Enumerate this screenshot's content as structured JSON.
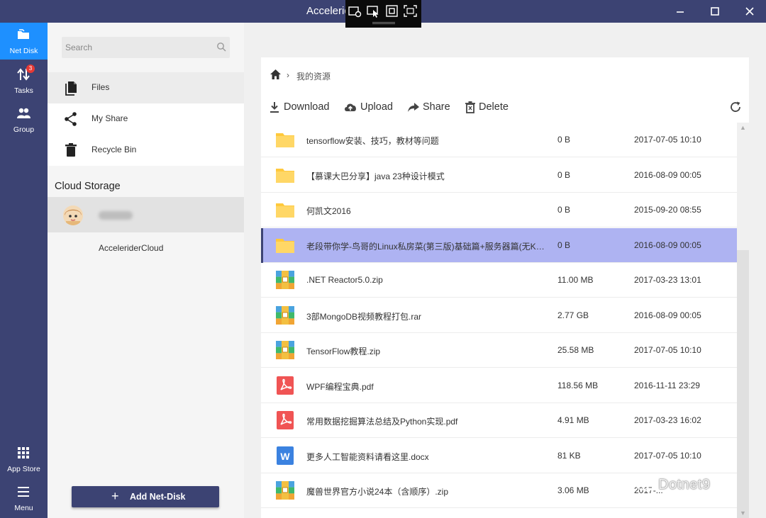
{
  "window": {
    "title": "Accelerider"
  },
  "nav": [
    {
      "label": "Net Disk",
      "icon": "folder-icon",
      "active": true
    },
    {
      "label": "Tasks",
      "icon": "transfer-arrows-icon",
      "badge": "3"
    },
    {
      "label": "Group",
      "icon": "group-icon"
    },
    {
      "label": "App Store",
      "icon": "apps-grid-icon"
    },
    {
      "label": "Menu",
      "icon": "menu-icon"
    }
  ],
  "sidebar": {
    "search_placeholder": "Search",
    "items": [
      {
        "label": "Files",
        "icon": "file-icon"
      },
      {
        "label": "My Share",
        "icon": "share-icon"
      },
      {
        "label": "Recycle Bin",
        "icon": "trash-icon"
      }
    ],
    "cloud_storage_title": "Cloud Storage",
    "cloud_items": [
      "AcceleriderCloud"
    ],
    "add_button": "Add Net-Disk"
  },
  "breadcrumb": {
    "current": "我的资源"
  },
  "actions": [
    "Download",
    "Upload",
    "Share",
    "Delete"
  ],
  "files": [
    {
      "name": "tensorflow安装、技巧，教材等问题",
      "size": "0 B",
      "date": "2017-07-05 10:10",
      "type": "folder"
    },
    {
      "name": "【慕课大巴分享】java 23种设计模式",
      "size": "0 B",
      "date": "2016-08-09 00:05",
      "type": "folder"
    },
    {
      "name": "何凯文2016",
      "size": "0 B",
      "date": "2015-09-20 08:55",
      "type": "folder"
    },
    {
      "name": "老段带你学-鸟哥的Linux私房菜(第三版)基础篇+服务器篇(无KE…",
      "size": "0 B",
      "date": "2016-08-09 00:05",
      "type": "folder",
      "selected": true
    },
    {
      "name": ".NET Reactor5.0.zip",
      "size": "11.00 MB",
      "date": "2017-03-23 13:01",
      "type": "archive"
    },
    {
      "name": "3部MongoDB视频教程打包.rar",
      "size": "2.77 GB",
      "date": "2016-08-09 00:05",
      "type": "archive"
    },
    {
      "name": "TensorFlow教程.zip",
      "size": "25.58 MB",
      "date": "2017-07-05 10:10",
      "type": "archive"
    },
    {
      "name": "WPF编程宝典.pdf",
      "size": "118.56 MB",
      "date": "2016-11-11 23:29",
      "type": "pdf"
    },
    {
      "name": "常用数据挖掘算法总结及Python实现.pdf",
      "size": "4.91 MB",
      "date": "2017-03-23 16:02",
      "type": "pdf"
    },
    {
      "name": "更多人工智能资料请看这里.docx",
      "size": "81 KB",
      "date": "2017-07-05 10:10",
      "type": "word"
    },
    {
      "name": "魔兽世界官方小说24本（含顺序）.zip",
      "size": "3.06 MB",
      "date": "2017-...",
      "type": "archive"
    }
  ],
  "watermark": "Dotnet9",
  "colors": {
    "nav": "#3c4373",
    "accent": "#1e90ff",
    "selected_row": "#aeb3f2",
    "folder": "#ffc93c",
    "pdf": "#f05454",
    "word": "#3b82e0"
  }
}
